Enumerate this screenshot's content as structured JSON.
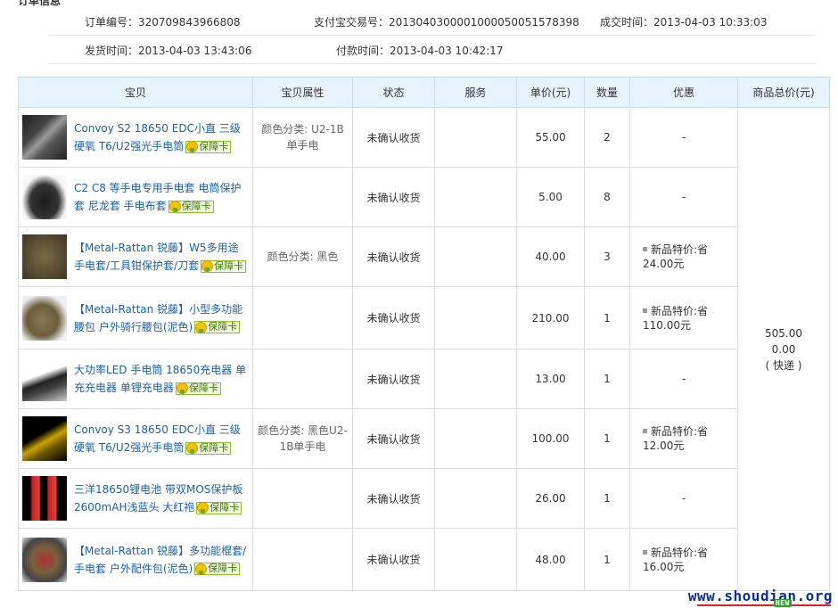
{
  "section_title": "订单信息",
  "info": {
    "order_no": "订单编号：320709843966808",
    "alipay_no": "支付宝交易号：2013040300001000050051578398",
    "deal_time": "成交时间：2013-04-03 10:33:03",
    "ship_time": "发货时间：2013-04-03 13:43:06",
    "pay_time": "付款时间：2013-04-03 10:42:17"
  },
  "columns": [
    "宝贝",
    "宝贝属性",
    "状态",
    "服务",
    "单价(元)",
    "数量",
    "优惠",
    "商品总价(元)"
  ],
  "badge_label": "保障卡",
  "items": [
    {
      "name": "Convoy S2 18650 EDC小直 三级硬氧 T6/U2强光手电筒",
      "attr": "颜色分类: U2-1B单手电",
      "status": "未确认收货",
      "service": "",
      "price": "55.00",
      "qty": "2",
      "discount": "-",
      "thumb": "flashlight-thumb"
    },
    {
      "name": "C2 C8 等手电专用手电套 电筒保护套 尼龙套 手电布套",
      "attr": "",
      "status": "未确认收货",
      "service": "",
      "price": "5.00",
      "qty": "8",
      "discount": "-",
      "thumb": "holster-thumb"
    },
    {
      "name": "【Metal-Rattan 锐藤】W5多用途手电套/工具钳保护套/刀套",
      "attr": "颜色分类: 黑色",
      "status": "未确认收货",
      "service": "",
      "price": "40.00",
      "qty": "3",
      "discount": "新品特价:省24.00元",
      "thumb": "pouch-thumb"
    },
    {
      "name": "【Metal-Rattan 锐藤】小型多功能腰包 户外骑行腰包(泥色)",
      "attr": "",
      "status": "未确认收货",
      "service": "",
      "price": "210.00",
      "qty": "1",
      "discount": "新品特价:省110.00元",
      "thumb": "waistbag-thumb"
    },
    {
      "name": "大功率LED 手电筒 18650充电器 单充充电器 单锂充电器",
      "attr": "",
      "status": "未确认收货",
      "service": "",
      "price": "13.00",
      "qty": "1",
      "discount": "-",
      "thumb": "charger-thumb"
    },
    {
      "name": "Convoy S3 18650 EDC小直 三级硬氧 T6/U2强光手电筒",
      "attr": "颜色分类: 黑色U2-1B单手电",
      "status": "未确认收货",
      "service": "",
      "price": "100.00",
      "qty": "1",
      "discount": "新品特价:省12.00元",
      "thumb": "flashlight2-thumb"
    },
    {
      "name": "三洋18650锂电池 带双MOS保护板 2600mAH浅蓝头 大红袍",
      "attr": "",
      "status": "未确认收货",
      "service": "",
      "price": "26.00",
      "qty": "1",
      "discount": "-",
      "thumb": "battery-thumb"
    },
    {
      "name": "【Metal-Rattan 锐藤】多功能棍套/手电套 户外配件包(泥色)",
      "attr": "",
      "status": "未确认收货",
      "service": "",
      "price": "48.00",
      "qty": "1",
      "discount": "新品特价:省16.00元",
      "thumb": "accessory-pack-thumb"
    }
  ],
  "total": {
    "amount": "505.00",
    "shipping": "0.00",
    "shipping_method": "( 快递 )"
  },
  "watermark": "www.shoudian.org",
  "watermark_badge": "NEW"
}
